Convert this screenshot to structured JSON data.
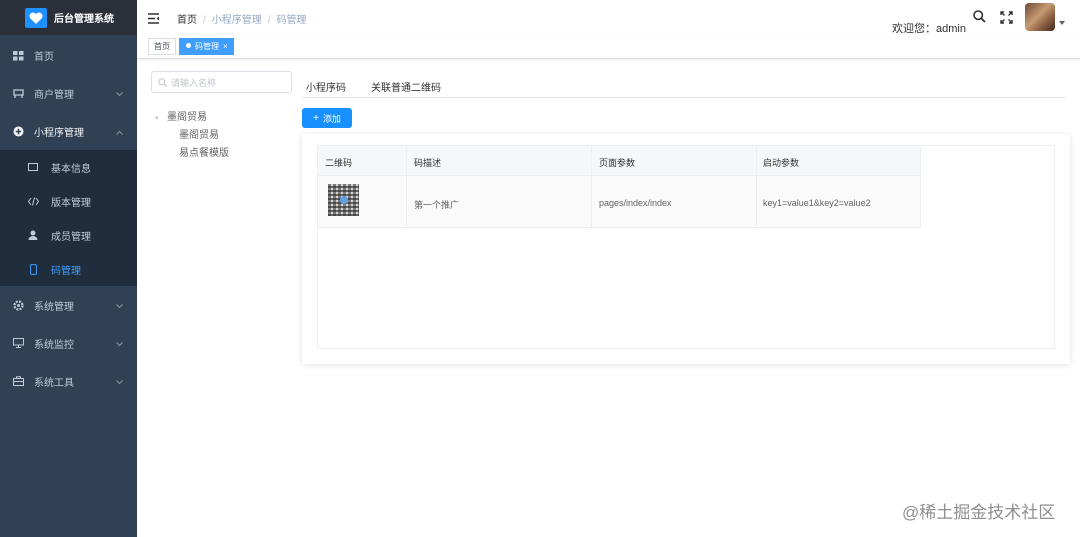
{
  "app": {
    "title": "后台管理系统"
  },
  "sidebar": {
    "items": [
      {
        "label": "首页",
        "icon": "dashboard-icon"
      },
      {
        "label": "商户管理",
        "icon": "shop-icon",
        "expandable": true
      },
      {
        "label": "小程序管理",
        "icon": "plus-circle-icon",
        "expandable": true,
        "expanded": true
      },
      {
        "label": "系统管理",
        "icon": "gear-icon",
        "expandable": true
      },
      {
        "label": "系统监控",
        "icon": "monitor-icon",
        "expandable": true
      },
      {
        "label": "系统工具",
        "icon": "toolbox-icon",
        "expandable": true
      }
    ],
    "subitems": [
      {
        "label": "基本信息",
        "icon": "card-icon"
      },
      {
        "label": "版本管理",
        "icon": "code-icon"
      },
      {
        "label": "成员管理",
        "icon": "user-icon"
      },
      {
        "label": "码管理",
        "icon": "phone-icon",
        "active": true
      }
    ]
  },
  "header": {
    "breadcrumb": [
      "首页",
      "小程序管理",
      "码管理"
    ],
    "welcome": "欢迎您：admin"
  },
  "tags": {
    "home": "首页",
    "active": "码管理",
    "close": "×"
  },
  "tree": {
    "search_placeholder": "请输入名称",
    "root": "墨阁贸易",
    "children": [
      "墨阁贸易",
      "易点餐模版"
    ]
  },
  "tabs": [
    "小程序码",
    "关联普通二维码"
  ],
  "add_button": "添加",
  "table": {
    "headers": [
      "二维码",
      "码描述",
      "页面参数",
      "启动参数"
    ],
    "rows": [
      {
        "desc": "第一个推广",
        "page": "pages/index/index",
        "params": "key1=value1&key2=value2"
      }
    ]
  },
  "watermark": "@稀土掘金技术社区",
  "colors": {
    "sidebar": "#304156",
    "accent": "#409eff",
    "button": "#1890ff"
  }
}
